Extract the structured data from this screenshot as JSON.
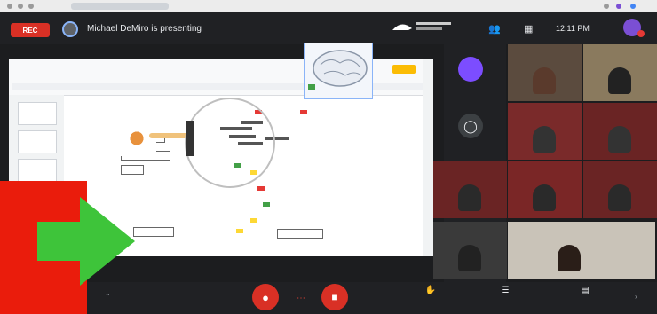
{
  "header": {
    "recording_label": "REC",
    "presenter_text": "Michael DeMiro is presenting",
    "time": "12:11 PM"
  },
  "colors": {
    "accent_red": "#d93025",
    "overlay_red": "#ea1c0c",
    "overlay_green": "#3ec43a",
    "meet_dark": "#202124"
  },
  "icons": [
    "rec-badge",
    "people-icon",
    "chat-icon",
    "mic-off-icon",
    "hangup-icon",
    "camera-off-icon",
    "caption-icon",
    "present-icon",
    "more-icon",
    "arrow-right-icon"
  ],
  "bottom": {
    "item1": "",
    "item2": "",
    "item3": ""
  }
}
